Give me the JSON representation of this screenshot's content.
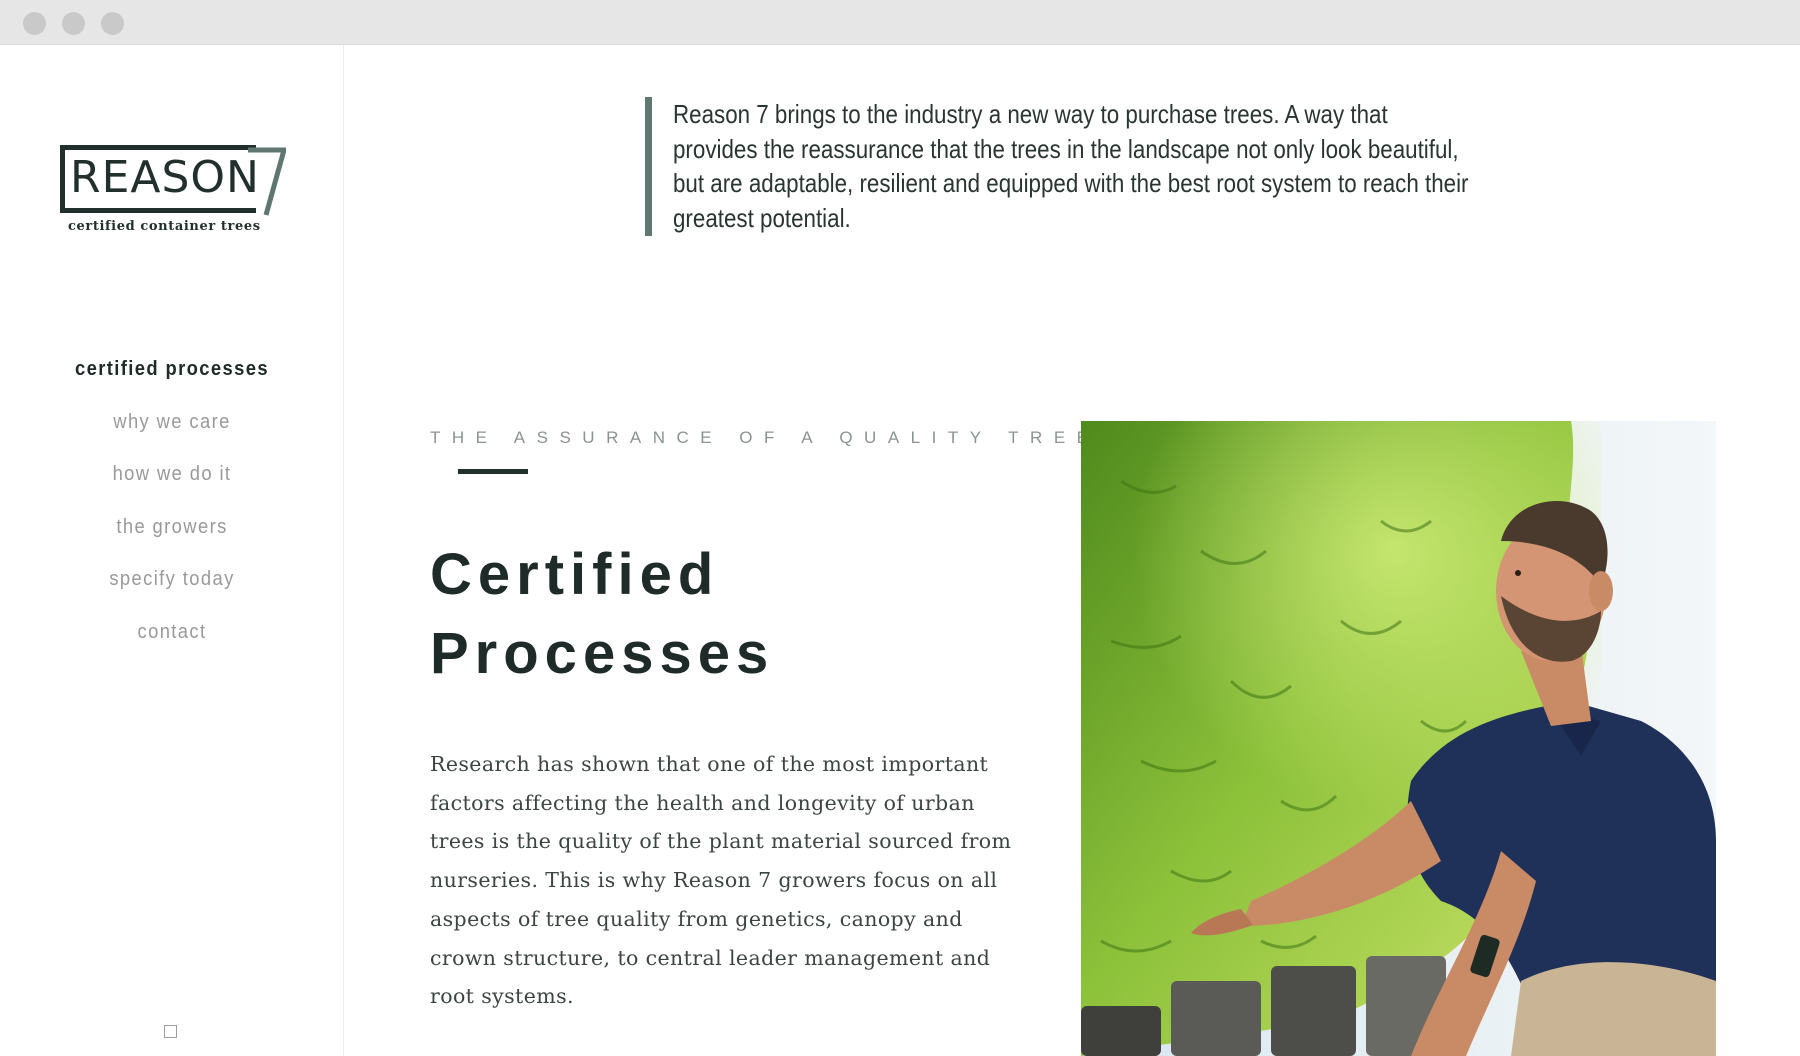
{
  "window": {
    "controls": [
      "close",
      "minimize",
      "maximize"
    ]
  },
  "brand": {
    "wordmark": "REASON",
    "numeral": "7",
    "tagline": "certified container trees",
    "color": "#22302d"
  },
  "nav": {
    "items": [
      {
        "label": "certified processes",
        "active": true
      },
      {
        "label": "why we care",
        "active": false
      },
      {
        "label": "how we do it",
        "active": false
      },
      {
        "label": "the growers",
        "active": false
      },
      {
        "label": "specify today",
        "active": false
      },
      {
        "label": "contact",
        "active": false
      }
    ]
  },
  "intro": {
    "quote": "Reason 7 brings to the industry a new way to purchase trees. A way that provides the reassurance that the trees in the landscape not only look beautiful, but are adaptable, resilient and equipped with the best root system to reach their greatest potential."
  },
  "section": {
    "eyebrow": "THE ASSURANCE OF A QUALITY TREE",
    "title_line1": "Certified",
    "title_line2": "Processes",
    "body": "Research has shown that one of the most important factors affecting the health and longevity of urban trees is the quality of the plant material sourced from nurseries. This is why Reason 7 growers focus on all aspects of tree quality from genetics, canopy and crown structure, to central leader management and root systems."
  },
  "photo": {
    "subject": "grower inspecting hedge of container trees"
  },
  "colors": {
    "accent": "#607771",
    "text_dark": "#1f2b28",
    "nav_muted": "#999999",
    "foliage": "#6fa02a",
    "shirt": "#1f3158"
  }
}
